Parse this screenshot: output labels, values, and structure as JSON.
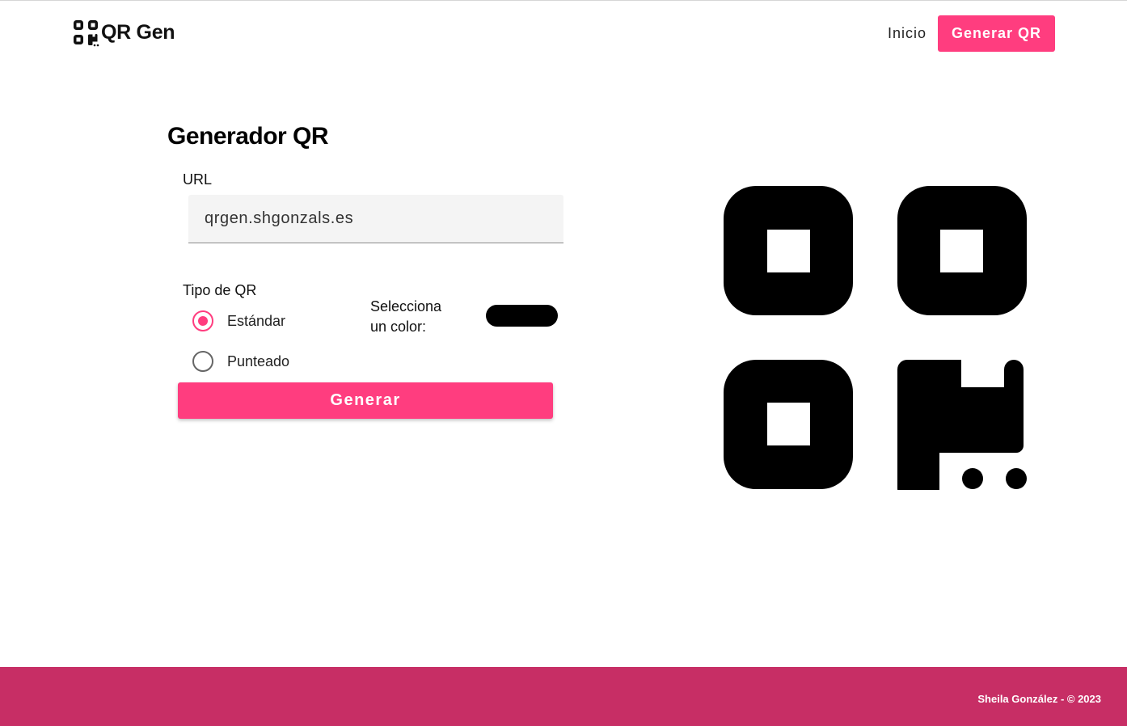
{
  "header": {
    "brand": "QR Gen",
    "logo_icon": "qr-code-icon",
    "nav_home": "Inicio",
    "nav_generate": "Generar QR"
  },
  "form": {
    "title": "Generador QR",
    "url_label": "URL",
    "url_value": "qrgen.shgonzals.es",
    "type_label": "Tipo de QR",
    "options": [
      {
        "label": "Estándar",
        "checked": true
      },
      {
        "label": "Punteado",
        "checked": false
      }
    ],
    "color_label": "Selecciona un color:",
    "color_value": "#000000",
    "submit_label": "Generar"
  },
  "preview": {
    "icon": "qr-code-icon",
    "color": "#000000"
  },
  "footer": {
    "text": "Sheila González - © 2023"
  },
  "colors": {
    "accent": "#ff3d7f",
    "footer_bg": "#c72e65"
  }
}
